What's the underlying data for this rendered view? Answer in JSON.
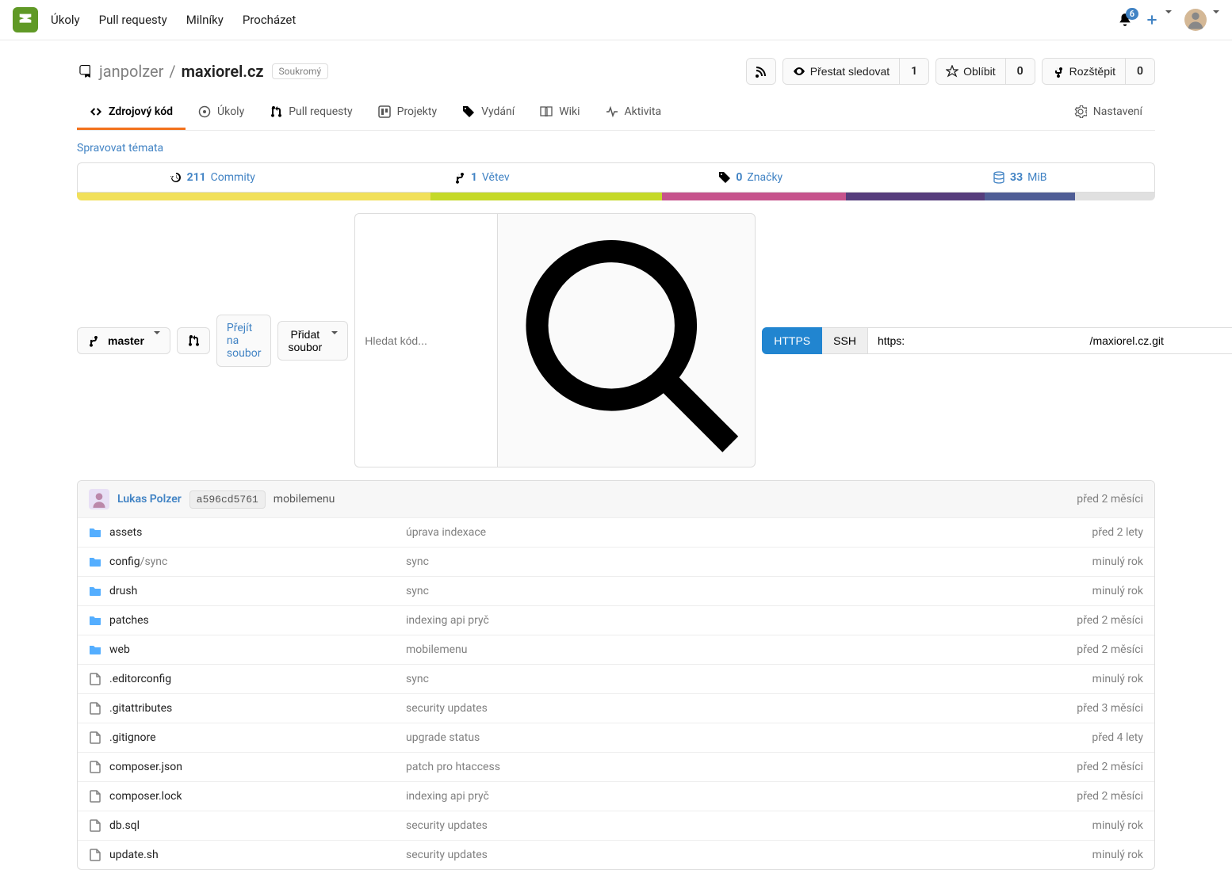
{
  "notifications_count": "6",
  "top_nav": [
    "Úkoly",
    "Pull requesty",
    "Milníky",
    "Procházet"
  ],
  "repo": {
    "owner": "janpolzer",
    "sep": "/",
    "name": "maxiorel.cz",
    "private_label": "Soukromý"
  },
  "actions": {
    "watch": "Přestat sledovat",
    "watch_count": "1",
    "star": "Oblíbit",
    "star_count": "0",
    "fork": "Rozštěpit",
    "fork_count": "0"
  },
  "tabs": {
    "code": "Zdrojový kód",
    "issues": "Úkoly",
    "pulls": "Pull requesty",
    "projects": "Projekty",
    "releases": "Vydání",
    "wiki": "Wiki",
    "activity": "Aktivita",
    "settings": "Nastavení"
  },
  "manage_topics": "Spravovat témata",
  "stats": {
    "commits_n": "211",
    "commits_l": "Commity",
    "branches_n": "1",
    "branches_l": "Větev",
    "tags_n": "0",
    "tags_l": "Značky",
    "size_n": "33",
    "size_l": "MiB"
  },
  "lang_segments": [
    {
      "color": "#f1e05a",
      "pct": 32.8
    },
    {
      "color": "#c5d928",
      "pct": 21.5
    },
    {
      "color": "#c6538c",
      "pct": 17.0
    },
    {
      "color": "#563d7c",
      "pct": 12.9
    },
    {
      "color": "#4F5D95",
      "pct": 8.4
    },
    {
      "color": "#e0e0e0",
      "pct": 7.4
    }
  ],
  "toolbar": {
    "branch": "master",
    "find_file": "Přejít na soubor",
    "add_file": "Přidat soubor",
    "search_placeholder": "Hledat kód...",
    "https": "HTTPS",
    "ssh": "SSH",
    "clone_url_suffix": "/maxiorel.cz.git",
    "clone_url_prefix": "https:"
  },
  "latest": {
    "author": "Lukas Polzer",
    "hash": "a596cd5761",
    "message": "mobilemenu",
    "time": "před 2 měsíci"
  },
  "files": [
    {
      "type": "dir",
      "name": "assets",
      "msg": "úprava indexace",
      "time": "před 2 lety"
    },
    {
      "type": "dir",
      "name": "config",
      "subpath": "/sync",
      "msg": "sync",
      "time": "minulý rok"
    },
    {
      "type": "dir",
      "name": "drush",
      "msg": "sync",
      "time": "minulý rok"
    },
    {
      "type": "dir",
      "name": "patches",
      "msg": "indexing api pryč",
      "time": "před 2 měsíci"
    },
    {
      "type": "dir",
      "name": "web",
      "msg": "mobilemenu",
      "time": "před 2 měsíci"
    },
    {
      "type": "file",
      "name": ".editorconfig",
      "msg": "sync",
      "time": "minulý rok"
    },
    {
      "type": "file",
      "name": ".gitattributes",
      "msg": "security updates",
      "time": "před 3 měsíci"
    },
    {
      "type": "file",
      "name": ".gitignore",
      "msg": "upgrade status",
      "time": "před 4 lety"
    },
    {
      "type": "file",
      "name": "composer.json",
      "msg": "patch pro htaccess",
      "time": "před 2 měsíci"
    },
    {
      "type": "file",
      "name": "composer.lock",
      "msg": "indexing api pryč",
      "time": "před 2 měsíci"
    },
    {
      "type": "file",
      "name": "db.sql",
      "msg": "security updates",
      "time": "minulý rok"
    },
    {
      "type": "file",
      "name": "update.sh",
      "msg": "security updates",
      "time": "minulý rok"
    }
  ]
}
